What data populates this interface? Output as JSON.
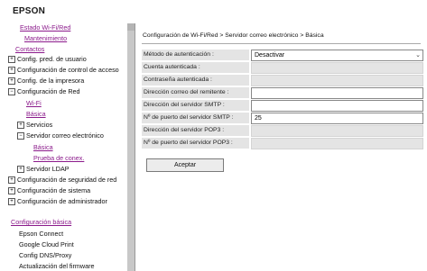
{
  "header": {
    "logo": "EPSON"
  },
  "sidebar": {
    "status_wifi": "Estado Wi-Fi/Red",
    "maintenance": "Mantenimiento",
    "contacts": "Contactos",
    "user_default": "Config. pred. de usuario",
    "access_control": "Configuración de control de acceso",
    "printer_config": "Config. de la impresora",
    "network_config": "Configuración de Red",
    "wifi": "Wi-Fi",
    "basic": "Básica",
    "services": "Servicios",
    "mail_server": "Servidor correo electrónico",
    "mail_basic": "Básica",
    "connection_test": "Prueba de conex.",
    "ldap": "Servidor LDAP",
    "security_config": "Configuración de seguridad de red",
    "system_config": "Configuración de sistema",
    "admin_config": "Configuración de administrador",
    "basic_config_link": "Configuración básica",
    "epson_connect": "Epson Connect",
    "google_cloud": "Google Cloud Print",
    "dns_proxy": "Config DNS/Proxy",
    "firmware": "Actualización del firmware"
  },
  "main": {
    "breadcrumb": "Configuración de Wi-Fi/Red > Servidor correo electrónico > Básica",
    "fields": {
      "auth_method_label": "Método de autenticación :",
      "auth_method_value": "Desactivar",
      "auth_account_label": "Cuenta autenticada :",
      "auth_password_label": "Contraseña autenticada :",
      "sender_label": "Dirección correo del remitente :",
      "smtp_address_label": "Dirección del servidor SMTP :",
      "smtp_port_label": "Nº de puerto del servidor SMTP :",
      "smtp_port_value": "25",
      "pop3_address_label": "Dirección del servidor POP3 :",
      "pop3_port_label": "Nº de puerto del servidor POP3 :"
    },
    "accept_label": "Aceptar"
  }
}
